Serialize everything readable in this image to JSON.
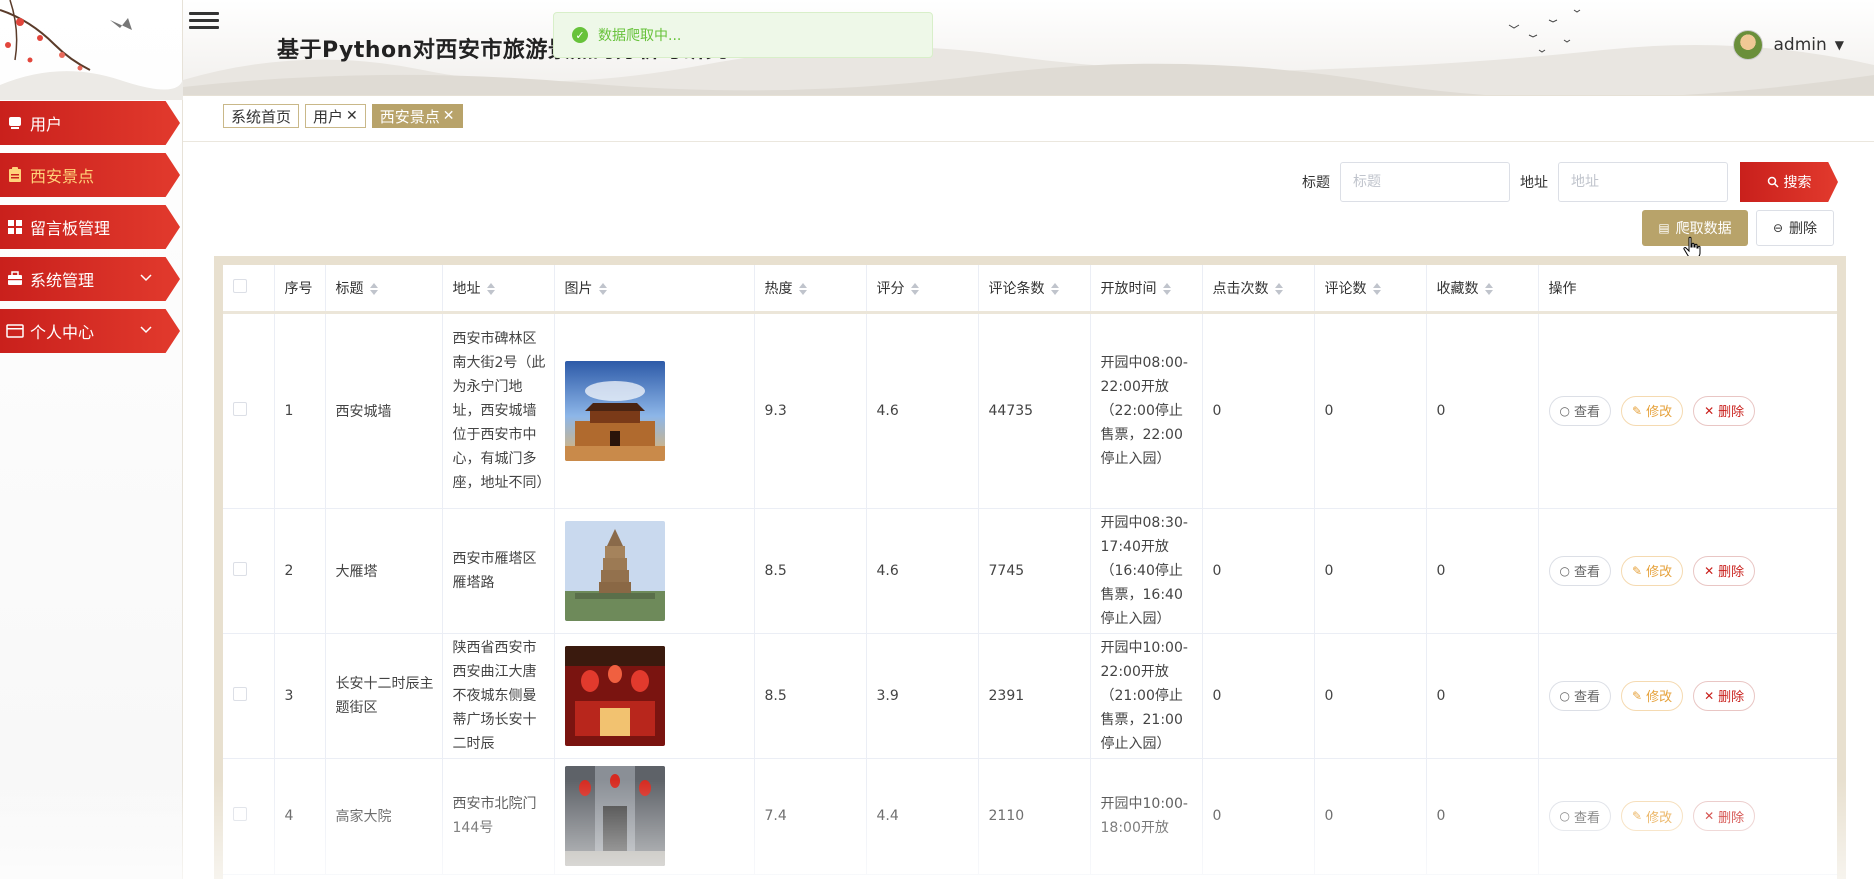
{
  "header": {
    "title": "基于Python对西安市旅游景点的分析与研究",
    "username": "admin"
  },
  "toast": {
    "message": "数据爬取中..."
  },
  "sidebar": {
    "items": [
      {
        "label": "用户",
        "icon": "user-icon",
        "active": false,
        "expandable": false
      },
      {
        "label": "西安景点",
        "icon": "clipboard-icon",
        "active": true,
        "expandable": false
      },
      {
        "label": "留言板管理",
        "icon": "grid-icon",
        "active": false,
        "expandable": false
      },
      {
        "label": "系统管理",
        "icon": "briefcase-icon",
        "active": false,
        "expandable": true
      },
      {
        "label": "个人中心",
        "icon": "card-icon",
        "active": false,
        "expandable": true
      }
    ]
  },
  "tabs": [
    {
      "label": "系统首页",
      "closable": false,
      "active": false
    },
    {
      "label": "用户",
      "closable": true,
      "active": false
    },
    {
      "label": "西安景点",
      "closable": true,
      "active": true
    }
  ],
  "search": {
    "title_label": "标题",
    "title_placeholder": "标题",
    "address_label": "地址",
    "address_placeholder": "地址",
    "search_button": "搜索"
  },
  "actions": {
    "crawl_button": "爬取数据",
    "delete_button": "删除"
  },
  "table": {
    "columns": [
      "序号",
      "标题",
      "地址",
      "图片",
      "热度",
      "评分",
      "评论条数",
      "开放时间",
      "点击次数",
      "评论数",
      "收藏数",
      "操作"
    ],
    "rows": [
      {
        "index": "1",
        "title": "西安城墙",
        "address": "西安市碑林区南大街2号（此为永宁门地址，西安城墙位于西安市中心，有城门多座，地址不同）",
        "heat": "9.3",
        "rating": "4.6",
        "comments": "44735",
        "open_time": "开园中08:00-22:00开放（22:00停止售票，22:00停止入园）",
        "clicks": "0",
        "comment_count": "0",
        "favorites": "0"
      },
      {
        "index": "2",
        "title": "大雁塔",
        "address": "西安市雁塔区雁塔路",
        "heat": "8.5",
        "rating": "4.6",
        "comments": "7745",
        "open_time": "开园中08:30-17:40开放（16:40停止售票，16:40停止入园）",
        "clicks": "0",
        "comment_count": "0",
        "favorites": "0"
      },
      {
        "index": "3",
        "title": "长安十二时辰主题街区",
        "address": "陕西省西安市西安曲江大唐不夜城东侧曼蒂广场长安十二时辰",
        "heat": "8.5",
        "rating": "3.9",
        "comments": "2391",
        "open_time": "开园中10:00-22:00开放（21:00停止售票，21:00停止入园）",
        "clicks": "0",
        "comment_count": "0",
        "favorites": "0"
      },
      {
        "index": "4",
        "title": "高家大院",
        "address": "西安市北院门144号",
        "heat": "7.4",
        "rating": "4.4",
        "comments": "2110",
        "open_time": "开园中10:00-18:00开放",
        "clicks": "0",
        "comment_count": "0",
        "favorites": "0"
      }
    ],
    "op_labels": {
      "view": "查看",
      "edit": "修改",
      "delete": "删除"
    }
  },
  "colors": {
    "primary_red": "#c9201c",
    "gold": "#b8a36a",
    "success": "#67c23a"
  }
}
